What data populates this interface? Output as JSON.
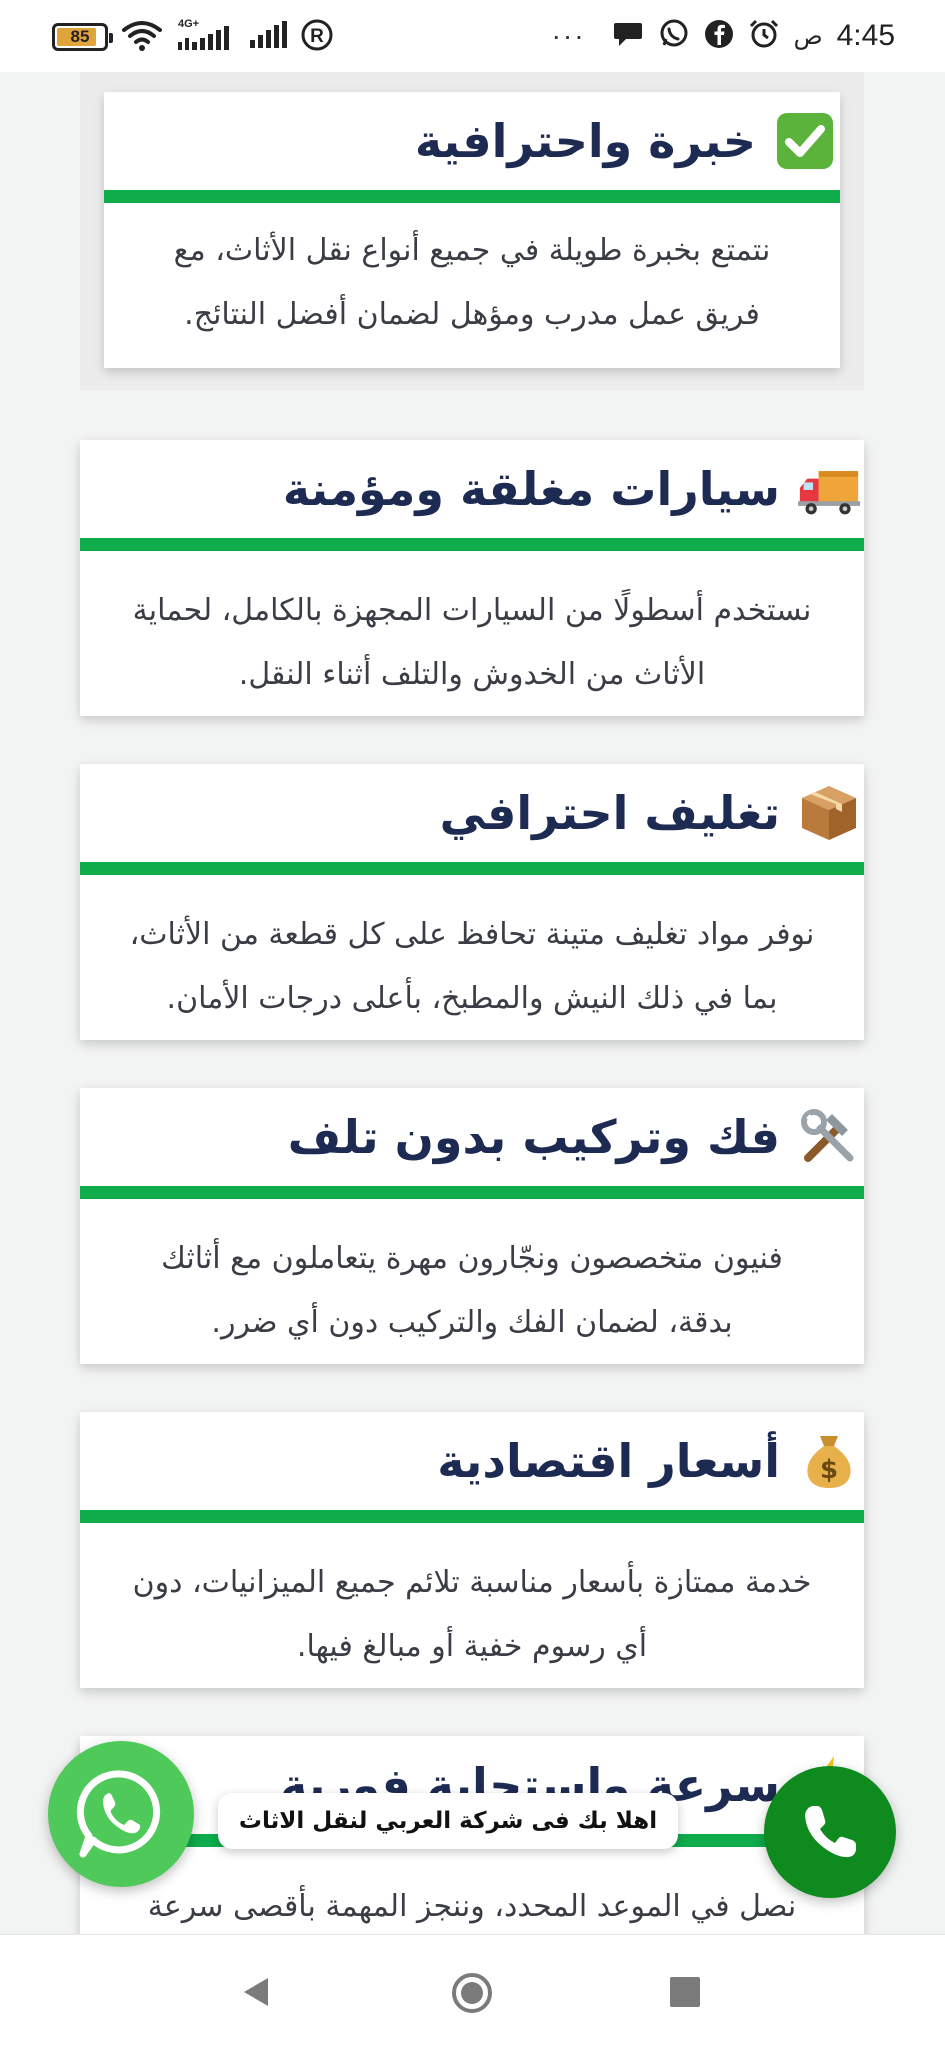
{
  "status_bar": {
    "battery_percent": "85",
    "battery_level": 0.85,
    "network_type": "4G+",
    "clock": "4:45",
    "am_pm": "ص",
    "more": "···",
    "icons": [
      "battery-icon",
      "wifi-icon",
      "signal-icon",
      "signal-icon",
      "registered-icon",
      "message-icon",
      "whatsapp-icon",
      "facebook-icon",
      "alarm-icon"
    ]
  },
  "cards": [
    {
      "title": "خبرة واحترافية",
      "emoji": "check-mark-icon",
      "text_line1": "نتمتع بخبرة طويلة في جميع أنواع نقل الأثاث، مع",
      "text_line2": "فريق عمل مدرب ومؤهل لضمان أفضل النتائج."
    },
    {
      "title": "سيارات مغلقة ومؤمنة",
      "emoji": "truck-icon",
      "text_line1": "نستخدم أسطولًا من السيارات المجهزة بالكامل، لحماية",
      "text_line2": "الأثاث من الخدوش والتلف أثناء النقل."
    },
    {
      "title": "تغليف احترافي",
      "emoji": "package-icon",
      "text_line1": "نوفر مواد تغليف متينة تحافظ على كل قطعة من الأثاث،",
      "text_line2": "بما في ذلك النيش والمطبخ، بأعلى درجات الأمان."
    },
    {
      "title": "فك وتركيب بدون تلف",
      "emoji": "tools-icon",
      "text_line1": "فنيون متخصصون ونجّارون مهرة يتعاملون مع أثاثك",
      "text_line2": "بدقة، لضمان الفك والتركيب دون أي ضرر."
    },
    {
      "title": "أسعار اقتصادية",
      "emoji": "money-bag-icon",
      "text_line1": "خدمة ممتازة بأسعار مناسبة تلائم جميع الميزانيات، دون",
      "text_line2": "أي رسوم خفية أو مبالغ فيها."
    },
    {
      "title": "سرعة واستجابة فورية",
      "emoji": "lightning-icon",
      "text_line1": "نصل في الموعد المحدد، وننجز المهمة بأقصى سرعة",
      "text_line2": ""
    }
  ],
  "whatsapp_bubble": "اهلا بك فى شركة العربي لنقل الاثاث",
  "colors": {
    "title": "#1d2a52",
    "accent_bar": "#0fac4c",
    "whatsapp": "#4ec95a",
    "call": "#0f8a1e",
    "page_bg": "#f2f3f3"
  },
  "nav": {
    "icons": [
      "back-icon",
      "home-icon",
      "recent-apps-icon"
    ]
  }
}
